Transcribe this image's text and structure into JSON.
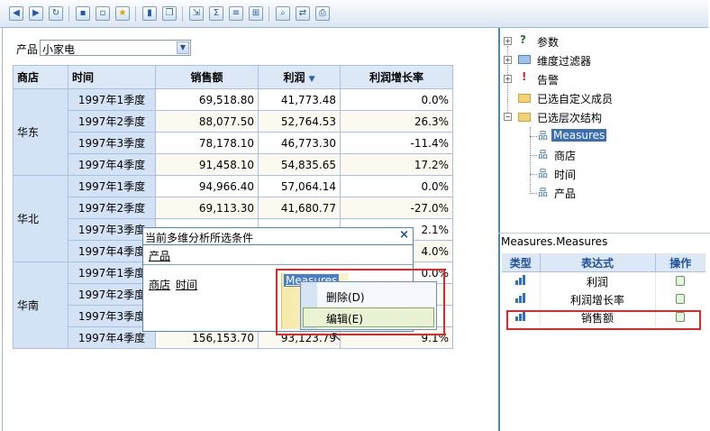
{
  "toolbar": {
    "icons": [
      "back-icon",
      "forward-icon",
      "refresh-icon",
      "save-icon",
      "save-as-icon",
      "favorite-icon",
      "chart-icon",
      "window-icon",
      "export-icon",
      "sum-icon",
      "properties-icon",
      "drill-icon",
      "zoom-icon",
      "swap-icon",
      "print-icon"
    ]
  },
  "product_filter": {
    "label": "产品",
    "value": "小家电"
  },
  "table": {
    "headers": [
      "商店",
      "时间",
      "销售额",
      "利润",
      "利润增长率"
    ],
    "sort_column": "利润",
    "groups": [
      {
        "store": "华东",
        "rows": [
          {
            "time": "1997年1季度",
            "sales": "69,518.80",
            "profit": "41,773.48",
            "growth": "0.0%"
          },
          {
            "time": "1997年2季度",
            "sales": "88,077.50",
            "profit": "52,764.53",
            "growth": "26.3%"
          },
          {
            "time": "1997年3季度",
            "sales": "78,178.10",
            "profit": "46,773.30",
            "growth": "-11.4%"
          },
          {
            "time": "1997年4季度",
            "sales": "91,458.10",
            "profit": "54,835.65",
            "growth": "17.2%"
          }
        ]
      },
      {
        "store": "华北",
        "rows": [
          {
            "time": "1997年1季度",
            "sales": "94,966.40",
            "profit": "57,064.14",
            "growth": "0.0%"
          },
          {
            "time": "1997年2季度",
            "sales": "69,113.30",
            "profit": "41,680.77",
            "growth": "-27.0%"
          },
          {
            "time": "1997年3季度",
            "sales": "",
            "profit": "",
            "growth": "2.1%"
          },
          {
            "time": "1997年4季度",
            "sales": "",
            "profit": "",
            "growth": "4.0%"
          }
        ]
      },
      {
        "store": "华南",
        "rows": [
          {
            "time": "1997年1季度",
            "sales": "",
            "profit": "",
            "growth": "0.0%"
          },
          {
            "time": "1997年2季度",
            "sales": "",
            "profit": "",
            "growth": ""
          },
          {
            "time": "1997年3季度",
            "sales": "",
            "profit": "",
            "growth": ""
          },
          {
            "time": "1997年4季度",
            "sales": "156,153.70",
            "profit": "93,123.79",
            "growth": "9.1%"
          }
        ]
      }
    ]
  },
  "filter_panel": {
    "title": "当前多维分析所选条件",
    "close": "×",
    "product": "产品",
    "rows": [
      "商店",
      "时间"
    ],
    "measures_tag": "Measures"
  },
  "context_menu": {
    "delete": "删除(D)",
    "edit": "编辑(E)"
  },
  "tree": {
    "params": "参数",
    "dim_filter": "维度过滤器",
    "alert": "告警",
    "custom_members": "已选自定义成员",
    "hierarchy": "已选层次结构",
    "children": [
      "Measures",
      "商店",
      "时间",
      "产品"
    ]
  },
  "measures_panel": {
    "title": "Measures.Measures",
    "headers": [
      "类型",
      "表达式",
      "操作"
    ],
    "rows": [
      "利润",
      "利润增长率",
      "销售额"
    ]
  },
  "colors": {
    "accent": "#4a86c9",
    "highlight": "#e02828",
    "header_bg": "#dde8f6"
  }
}
